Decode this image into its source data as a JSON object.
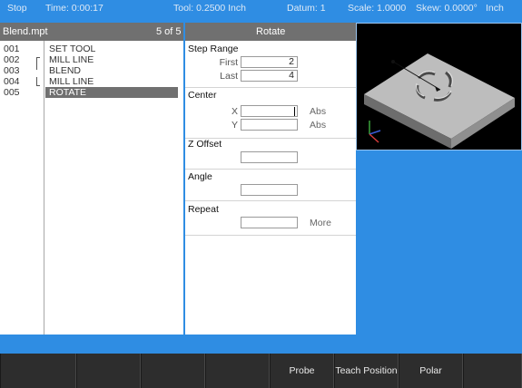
{
  "status": {
    "mode": "Stop",
    "time": "Time: 0:00:17",
    "tool": "Tool: 0.2500 Inch",
    "datum": "Datum: 1",
    "scale": "Scale: 1.0000",
    "skew": "Skew: 0.0000°",
    "unit": "Inch"
  },
  "program": {
    "filename": "Blend.mpt",
    "position": "5 of 5",
    "rows": [
      {
        "num": "001",
        "cmd": "SET TOOL"
      },
      {
        "num": "002",
        "cmd": "MILL LINE"
      },
      {
        "num": "003",
        "cmd": "BLEND"
      },
      {
        "num": "004",
        "cmd": "MILL LINE"
      },
      {
        "num": "005",
        "cmd": "ROTATE"
      }
    ]
  },
  "form": {
    "title": "Rotate",
    "step_range": {
      "label": "Step Range",
      "first_label": "First",
      "first_value": "2",
      "last_label": "Last",
      "last_value": "4"
    },
    "center": {
      "label": "Center",
      "x_label": "X",
      "x_value": "",
      "x_suffix": "Abs",
      "y_label": "Y",
      "y_value": "",
      "y_suffix": "Abs"
    },
    "z_offset": {
      "label": "Z Offset",
      "value": ""
    },
    "angle": {
      "label": "Angle",
      "value": ""
    },
    "repeat": {
      "label": "Repeat",
      "value": "",
      "suffix": "More"
    }
  },
  "softkeys": [
    "",
    "",
    "",
    "",
    "Probe",
    "Teach Position",
    "Polar",
    ""
  ],
  "colors": {
    "background": "#2f8de3",
    "panel": "#ffffff",
    "header": "#707070",
    "softkey": "#2d2d2d",
    "view": "#000000"
  }
}
